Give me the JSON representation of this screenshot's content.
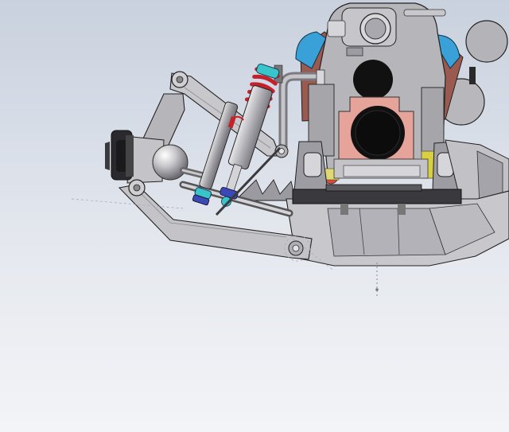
{
  "viewport": {
    "background": {
      "top": "#c9d1de",
      "bottom": "#f3f4f7"
    }
  },
  "model": {
    "colors": {
      "body_gray": "#b8b8bc",
      "dark_gray": "#5c5c60",
      "head_brown": "#9a5a4f",
      "block_pink": "#e6a39a",
      "cap_blue": "#3aa0d8",
      "spring_red": "#c4222a",
      "shock_cyan": "#38c4c8",
      "shock_blue": "#3a48b8",
      "fitting_yellow": "#d8d040",
      "fitting_red": "#d84a3a",
      "black": "#151515"
    }
  }
}
